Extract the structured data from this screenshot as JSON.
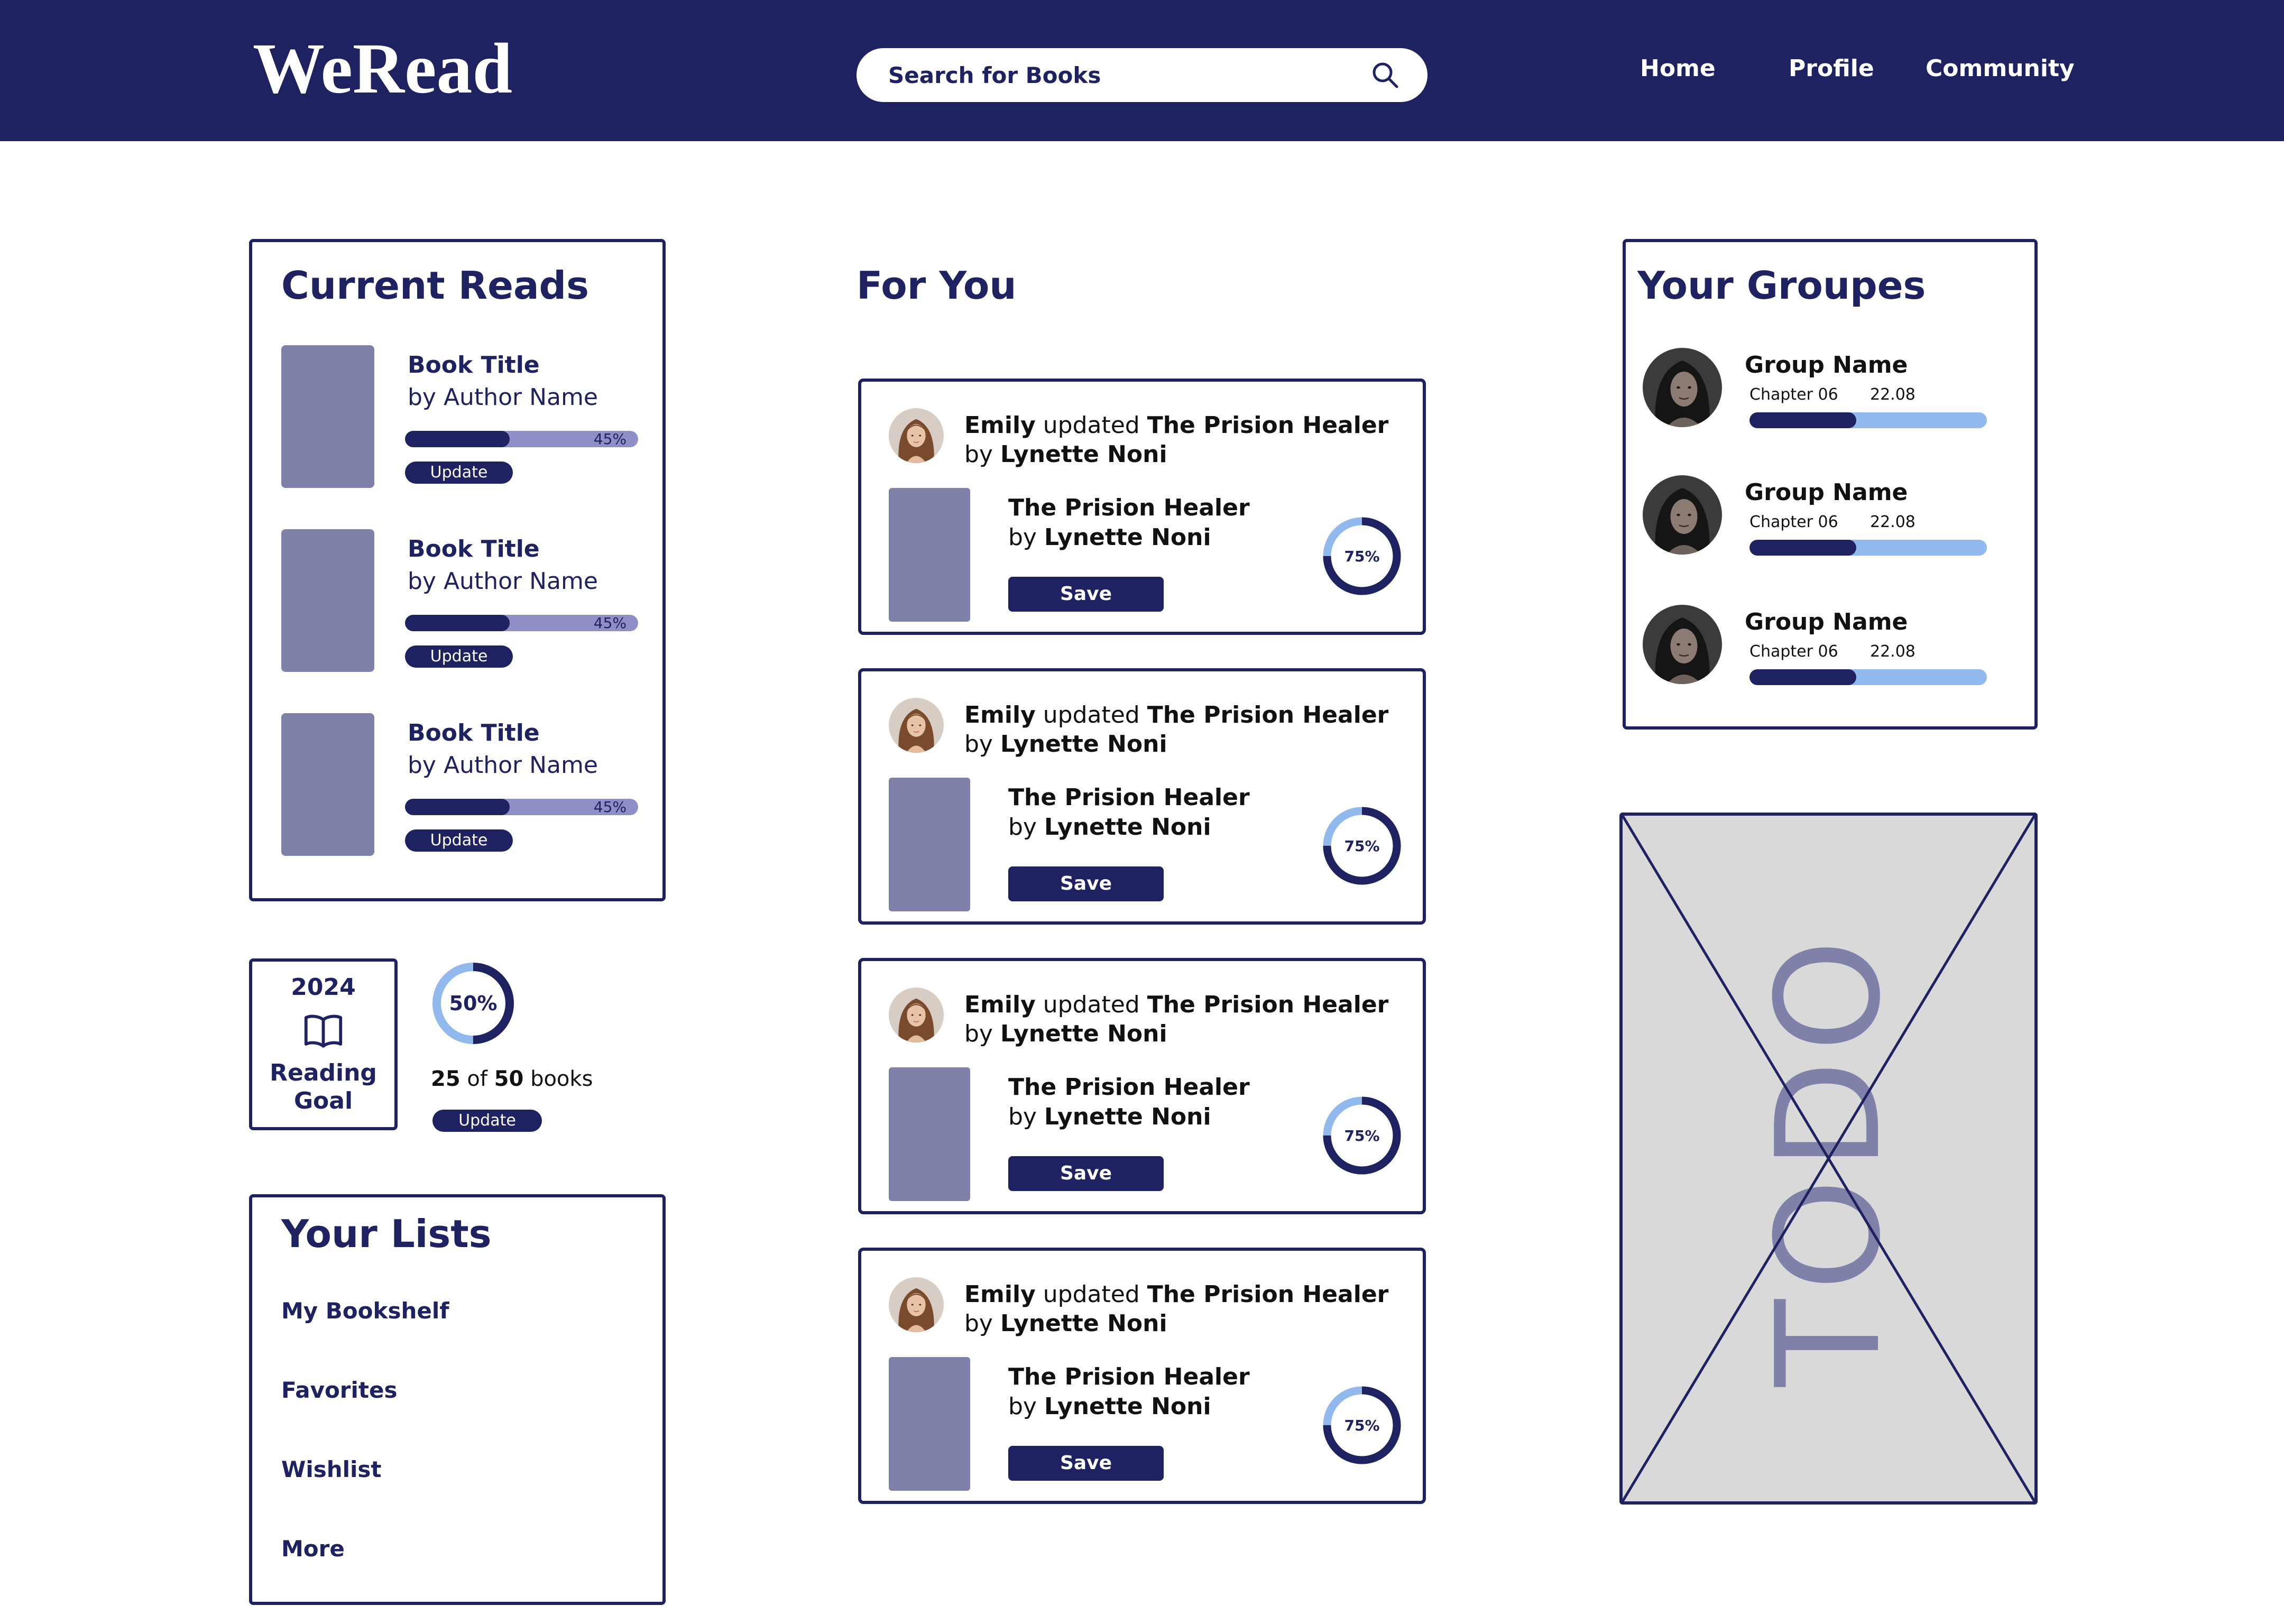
{
  "app": {
    "logo": "WeRead"
  },
  "header": {
    "search": {
      "placeholder": "Search for Books",
      "icon": "search-icon"
    },
    "nav": [
      {
        "label": "Home"
      },
      {
        "label": "Profile"
      },
      {
        "label": "Community"
      }
    ]
  },
  "current_reads": {
    "title": "Current Reads",
    "items": [
      {
        "title": "Book Title",
        "author": "by Author Name",
        "progress_percent": 45,
        "progress_label": "45%",
        "button": "Update"
      },
      {
        "title": "Book Title",
        "author": "by Author Name",
        "progress_percent": 45,
        "progress_label": "45%",
        "button": "Update"
      },
      {
        "title": "Book Title",
        "author": "by Author Name",
        "progress_percent": 45,
        "progress_label": "45%",
        "button": "Update"
      }
    ]
  },
  "reading_goal": {
    "year": "2024",
    "icon": "open-book-icon",
    "label_line1": "Reading",
    "label_line2": "Goal",
    "percent": 50,
    "percent_label": "50%",
    "books_read": "25",
    "of": "of",
    "books_total": "50",
    "unit": "books",
    "button": "Update"
  },
  "lists": {
    "title": "Your Lists",
    "items": [
      {
        "label": "My Bookshelf"
      },
      {
        "label": "Favorites"
      },
      {
        "label": "Wishlist"
      },
      {
        "label": "More"
      }
    ]
  },
  "for_you": {
    "title": "For You",
    "cards": [
      {
        "user": "Emily",
        "action": "updated",
        "book": "The Prision Healer",
        "by": "by",
        "author": "Lynette Noni",
        "book_title": "The Prision Healer",
        "book_by": "by",
        "book_author": "Lynette Noni",
        "button": "Save",
        "percent": 75,
        "percent_label": "75%"
      },
      {
        "user": "Emily",
        "action": "updated",
        "book": "The Prision Healer",
        "by": "by",
        "author": "Lynette Noni",
        "book_title": "The Prision Healer",
        "book_by": "by",
        "book_author": "Lynette Noni",
        "button": "Save",
        "percent": 75,
        "percent_label": "75%"
      },
      {
        "user": "Emily",
        "action": "updated",
        "book": "The Prision Healer",
        "by": "by",
        "author": "Lynette Noni",
        "book_title": "The Prision Healer",
        "book_by": "by",
        "book_author": "Lynette Noni",
        "button": "Save",
        "percent": 75,
        "percent_label": "75%"
      },
      {
        "user": "Emily",
        "action": "updated",
        "book": "The Prision Healer",
        "by": "by",
        "author": "Lynette Noni",
        "book_title": "The Prision Healer",
        "book_by": "by",
        "book_author": "Lynette Noni",
        "button": "Save",
        "percent": 75,
        "percent_label": "75%"
      }
    ]
  },
  "groups": {
    "title": "Your Groupes",
    "items": [
      {
        "name": "Group Name",
        "chapter": "Chapter 06",
        "date": "22.08",
        "progress_percent": 45
      },
      {
        "name": "Group Name",
        "chapter": "Chapter 06",
        "date": "22.08",
        "progress_percent": 45
      },
      {
        "name": "Group Name",
        "chapter": "Chapter 06",
        "date": "22.08",
        "progress_percent": 45
      }
    ]
  },
  "placeholder": {
    "text": "TODO"
  },
  "colors": {
    "primary": "#1e2260",
    "book_cover": "#7f81a8",
    "progress_track": "#8f8ec6",
    "accent_light_blue": "#91b9ee",
    "placeholder_bg": "#d9d9d9",
    "background": "#ffffff"
  }
}
